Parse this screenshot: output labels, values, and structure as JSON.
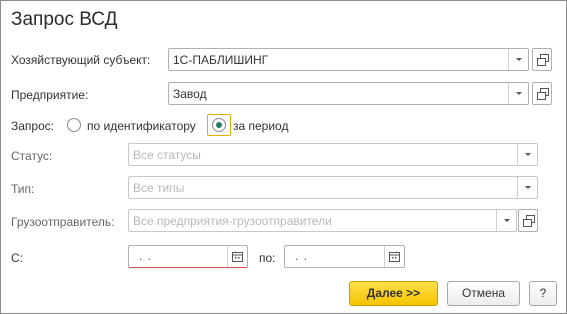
{
  "window": {
    "title": "Запрос ВСД"
  },
  "form": {
    "entity": {
      "label": "Хозяйствующий субъект:",
      "value": "1С-ПАБЛИШИНГ"
    },
    "enterprise": {
      "label": "Предприятие:",
      "value": "Завод"
    },
    "request": {
      "label": "Запрос:",
      "options": [
        "по идентификатору",
        "за период"
      ],
      "selected": "за период"
    },
    "status": {
      "label": "Статус:",
      "placeholder": "Все статусы"
    },
    "type": {
      "label": "Тип:",
      "placeholder": "Все типы"
    },
    "shipper": {
      "label": "Грузоотправитель:",
      "placeholder": "Все предприятия-грузоотправители"
    },
    "date_from": {
      "label": "С:",
      "value": " .  ."
    },
    "date_to": {
      "label": "по:",
      "value": " .  ."
    }
  },
  "buttons": {
    "next": "Далее >>",
    "cancel": "Отмена",
    "help": "?"
  },
  "colors": {
    "primary": "#f5c400",
    "radio_checked": "#2a7a6a",
    "focus": "#e0b400",
    "error": "#d9534f"
  }
}
